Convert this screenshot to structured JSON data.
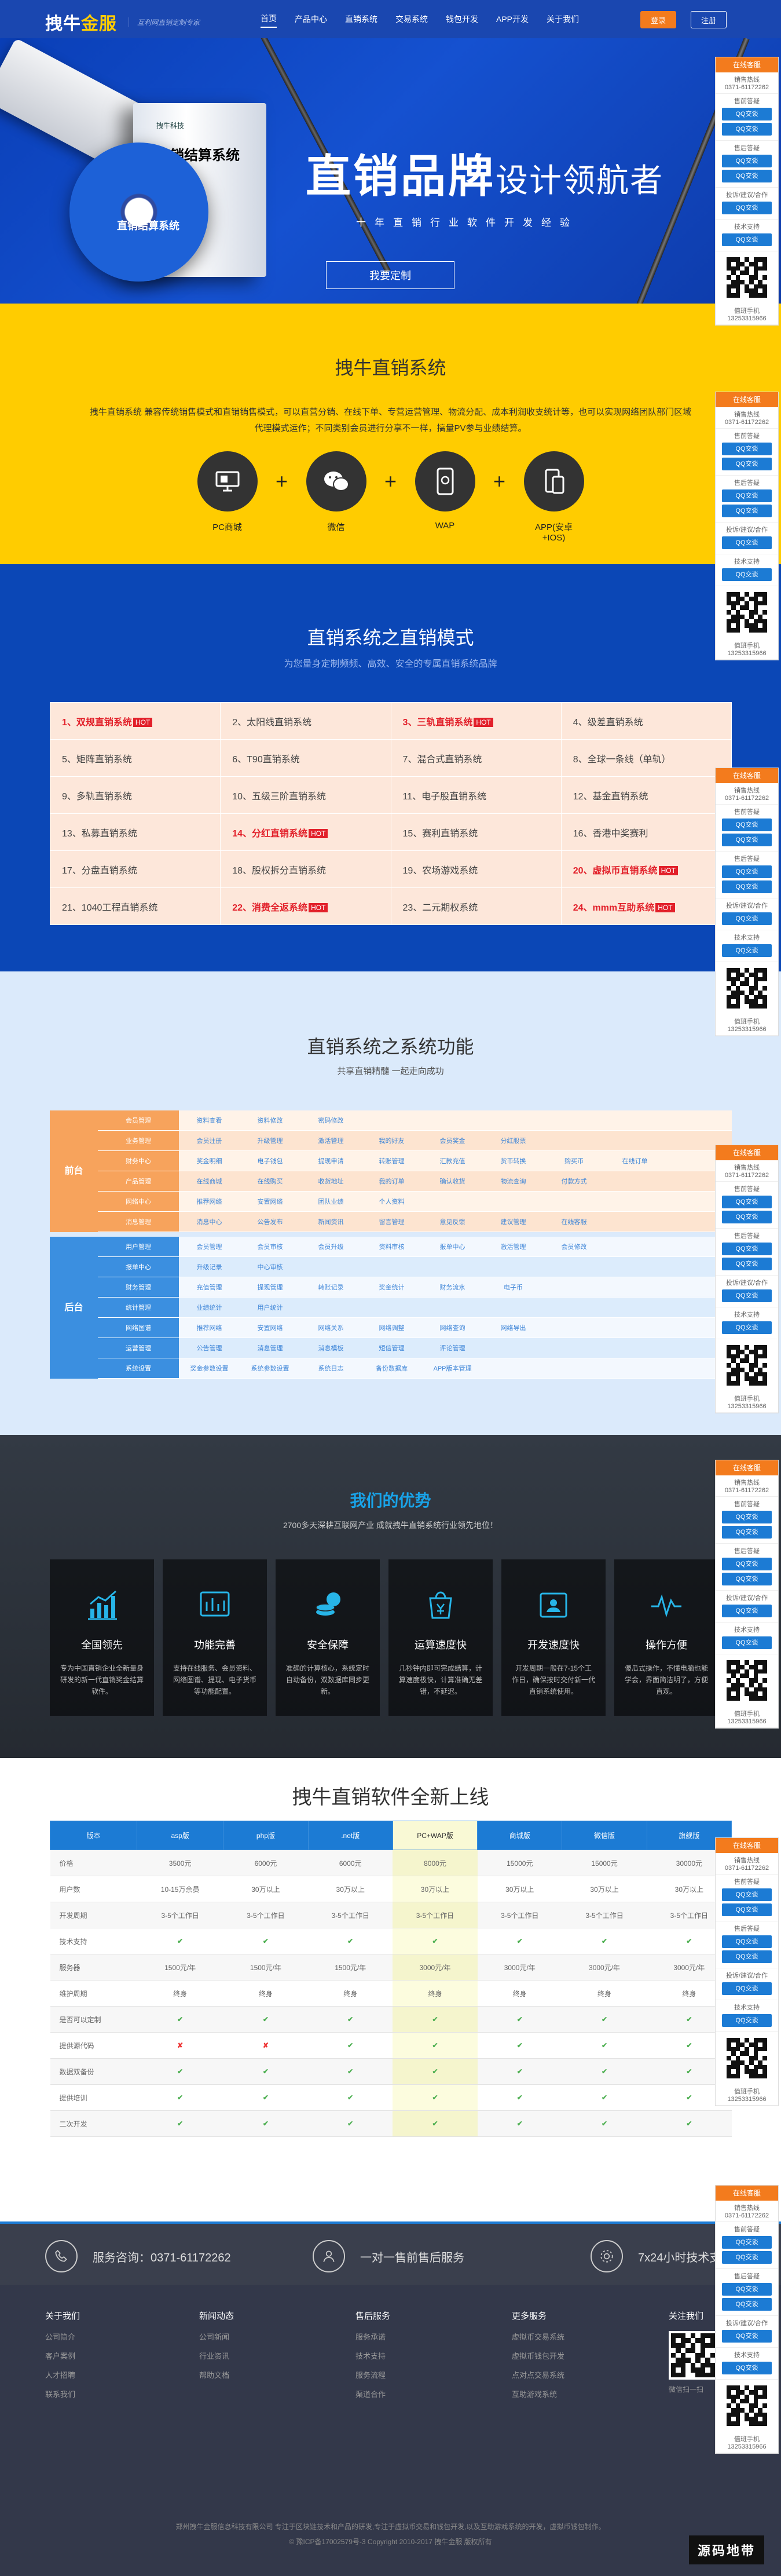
{
  "header": {
    "logo_main": "拽牛",
    "logo_accent": "金服",
    "slogan": "互利网直销定制专家",
    "nav": [
      "首页",
      "产品中心",
      "直销系统",
      "交易系统",
      "钱包开发",
      "APP开发",
      "关于我们"
    ],
    "login": "登录",
    "register": "注册"
  },
  "banner": {
    "box_brand": "拽牛科技",
    "box_title": "直销结算系统",
    "box_edition": "专业版",
    "disc_label": "直销结算系统",
    "title_big": "直销品牌",
    "title_small": "设计领航者",
    "subtitle": "十年直销行业软件开发经验",
    "button": "我要定制"
  },
  "system": {
    "title": "拽牛直销系统",
    "desc": "拽牛直销系统 兼容传统销售模式和直销销售模式，可以直营分销、在线下单、专营运营管理、物流分配、成本利润收支统计等，也可以实现网络团队部门区域代理模式运作；不同类别会员进行分享不一样，搞量PV参与业绩结算。",
    "items": [
      {
        "icon": "pc-icon",
        "label": "PC商城"
      },
      {
        "icon": "wechat-icon",
        "label": "微信"
      },
      {
        "icon": "wap-icon",
        "label": "WAP"
      },
      {
        "icon": "app-icon",
        "label": "APP(安卓+IOS)"
      }
    ]
  },
  "modes": {
    "title": "直销系统之直销模式",
    "subtitle": "为您量身定制频频、高效、安全的专属直销系统品牌",
    "hot_label": "HOT",
    "cells": [
      {
        "text": "1、双规直销系统",
        "hot": true
      },
      {
        "text": "2、太阳线直销系统",
        "hot": false
      },
      {
        "text": "3、三轨直销系统",
        "hot": true
      },
      {
        "text": "4、级差直销系统",
        "hot": false
      },
      {
        "text": "5、矩阵直销系统",
        "hot": false
      },
      {
        "text": "6、T90直销系统",
        "hot": false
      },
      {
        "text": "7、混合式直销系统",
        "hot": false
      },
      {
        "text": "8、全球一条线（单轨）",
        "hot": false
      },
      {
        "text": "9、多轨直销系统",
        "hot": false
      },
      {
        "text": "10、五级三阶直销系统",
        "hot": false
      },
      {
        "text": "11、电子股直销系统",
        "hot": false
      },
      {
        "text": "12、基金直销系统",
        "hot": false
      },
      {
        "text": "13、私募直销系统",
        "hot": false
      },
      {
        "text": "14、分红直销系统",
        "hot": true
      },
      {
        "text": "15、赛利直销系统",
        "hot": false
      },
      {
        "text": "16、香港中奖赛利",
        "hot": false
      },
      {
        "text": "17、分盘直销系统",
        "hot": false
      },
      {
        "text": "18、股权拆分直销系统",
        "hot": false
      },
      {
        "text": "19、农场游戏系统",
        "hot": false
      },
      {
        "text": "20、虚拟币直销系统",
        "hot": true
      },
      {
        "text": "21、1040工程直销系统",
        "hot": false
      },
      {
        "text": "22、消费全返系统",
        "hot": true
      },
      {
        "text": "23、二元期权系统",
        "hot": false
      },
      {
        "text": "24、mmm互助系统",
        "hot": true
      }
    ]
  },
  "func": {
    "title": "直销系统之系统功能",
    "subtitle": "共享直销精髓 一起走向成功",
    "front_label": "前台",
    "back_label": "后台",
    "front_rows": [
      {
        "name": "会员管理",
        "cells": [
          "资料查看",
          "资料修改",
          "密码修改"
        ]
      },
      {
        "name": "业务管理",
        "cells": [
          "会员注册",
          "升级管理",
          "激活管理",
          "我的好友",
          "会员奖金",
          "分红股票"
        ]
      },
      {
        "name": "财务中心",
        "cells": [
          "奖金明细",
          "电子钱包",
          "提现申请",
          "转账管理",
          "汇款充值",
          "货币转换",
          "购买币",
          "在线订单"
        ]
      },
      {
        "name": "产品管理",
        "cells": [
          "在线商城",
          "在线购买",
          "收货地址",
          "我的订单",
          "确认收货",
          "物流查询",
          "付款方式"
        ]
      },
      {
        "name": "网络中心",
        "cells": [
          "推荐网络",
          "安置网络",
          "团队业绩",
          "个人资料"
        ]
      },
      {
        "name": "消息管理",
        "cells": [
          "消息中心",
          "公告发布",
          "新闻资讯",
          "留言管理",
          "意见反馈",
          "建议管理",
          "在线客服"
        ]
      }
    ],
    "back_rows": [
      {
        "name": "用户管理",
        "cells": [
          "会员管理",
          "会员审核",
          "会员升级",
          "资料审核",
          "报单中心",
          "激活管理",
          "会员修改"
        ]
      },
      {
        "name": "报单中心",
        "cells": [
          "升级记录",
          "中心审核"
        ]
      },
      {
        "name": "财务管理",
        "cells": [
          "充值管理",
          "提现管理",
          "转账记录",
          "奖金统计",
          "财务流水",
          "电子币"
        ]
      },
      {
        "name": "统计管理",
        "cells": [
          "业绩统计",
          "用户统计"
        ]
      },
      {
        "name": "网络图谱",
        "cells": [
          "推荐网络",
          "安置网络",
          "网络关系",
          "网络调整",
          "网络查询",
          "网络导出"
        ]
      },
      {
        "name": "运营管理",
        "cells": [
          "公告管理",
          "消息管理",
          "消息模板",
          "短信管理",
          "评论管理"
        ]
      },
      {
        "name": "系统设置",
        "cells": [
          "奖金参数设置",
          "系统参数设置",
          "系统日志",
          "备份数据库",
          "APP版本管理"
        ]
      }
    ]
  },
  "adv": {
    "title": "我们的优势",
    "subtitle": "2700多天深耕互联网产业 成就拽牛直销系统行业领先地位！",
    "cards": [
      {
        "icon": "chart-icon",
        "title": "全国领先",
        "desc": "专为中国直销企业全新量身研发的新一代直销奖金结算软件。"
      },
      {
        "icon": "dashboard-icon",
        "title": "功能完善",
        "desc": "支持在线服务、会员资料、网络图谱、提现、电子货币等功能配置。"
      },
      {
        "icon": "coins-icon",
        "title": "安全保障",
        "desc": "准确的计算核心，系统定时自动备份，双数据库同步更新。"
      },
      {
        "icon": "yen-icon",
        "title": "运算速度快",
        "desc": "几秒钟内即可完成结算，计算速度极快，计算准确无差错，不延迟。"
      },
      {
        "icon": "user-card-icon",
        "title": "开发速度快",
        "desc": "开发周期一般在7-15个工作日，确保按时交付新一代直销系统使用。"
      },
      {
        "icon": "pulse-icon",
        "title": "操作方便",
        "desc": "傻瓜式操作，不懂电脑也能学会，界面简洁明了，方便直观。"
      }
    ]
  },
  "price": {
    "title": "拽牛直销软件全新上线",
    "headers": [
      "版本",
      "asp版",
      "php版",
      ".net版",
      "PC+WAP版",
      "商城版",
      "微信版",
      "旗舰版"
    ],
    "rows": [
      {
        "label": "价格",
        "cells": [
          "3500元",
          "6000元",
          "6000元",
          "8000元",
          "15000元",
          "15000元",
          "30000元"
        ]
      },
      {
        "label": "用户数",
        "cells": [
          "10-15万余员",
          "30万以上",
          "30万以上",
          "30万以上",
          "30万以上",
          "30万以上",
          "30万以上"
        ]
      },
      {
        "label": "开发周期",
        "cells": [
          "3-5个工作日",
          "3-5个工作日",
          "3-5个工作日",
          "3-5个工作日",
          "3-5个工作日",
          "3-5个工作日",
          "3-5个工作日"
        ]
      },
      {
        "label": "技术支持",
        "cells": [
          "ok",
          "ok",
          "ok",
          "ok",
          "ok",
          "ok",
          "ok"
        ]
      },
      {
        "label": "服务器",
        "cells": [
          "1500元/年",
          "1500元/年",
          "1500元/年",
          "3000元/年",
          "3000元/年",
          "3000元/年",
          "3000元/年"
        ]
      },
      {
        "label": "维护周期",
        "cells": [
          "终身",
          "终身",
          "终身",
          "终身",
          "终身",
          "终身",
          "终身"
        ]
      },
      {
        "label": "是否可以定制",
        "cells": [
          "ok",
          "ok",
          "ok",
          "ok",
          "ok",
          "ok",
          "ok"
        ]
      },
      {
        "label": "提供源代码",
        "cells": [
          "no",
          "no",
          "ok",
          "ok",
          "ok",
          "ok",
          "ok"
        ]
      },
      {
        "label": "数据双备份",
        "cells": [
          "ok",
          "ok",
          "ok",
          "ok",
          "ok",
          "ok",
          "ok"
        ]
      },
      {
        "label": "提供培训",
        "cells": [
          "ok",
          "ok",
          "ok",
          "ok",
          "ok",
          "ok",
          "ok"
        ]
      },
      {
        "label": "二次开发",
        "cells": [
          "ok",
          "ok",
          "ok",
          "ok",
          "ok",
          "ok",
          "ok"
        ]
      }
    ]
  },
  "service": {
    "phone": "服务咨询：0371-61172262",
    "after": "一对一售前售后服务",
    "support": "7x24小时技术支持"
  },
  "footer": {
    "cols": [
      {
        "title": "关于我们",
        "links": [
          "公司简介",
          "客户案例",
          "人才招聘",
          "联系我们"
        ]
      },
      {
        "title": "新闻动态",
        "links": [
          "公司新闻",
          "行业资讯",
          "帮助文档"
        ]
      },
      {
        "title": "售后服务",
        "links": [
          "服务承诺",
          "技术支持",
          "服务流程",
          "渠道合作"
        ]
      },
      {
        "title": "更多服务",
        "links": [
          "虚拟币交易系统",
          "虚拟币钱包开发",
          "点对点交易系统",
          "互助游戏系统"
        ]
      }
    ],
    "follow": "关注我们",
    "qr_label": "微信扫一扫",
    "copy1": "郑州拽牛金服信息科技有限公司 专注于区块链技术和产品的研发,专注于虚拟币交易和钱包开发,以及互助游戏系统的开发，虚拟币钱包制作。",
    "copy2": "© 豫ICP备17002579号-3 Copyright 2010-2017 拽牛金服 版权所有",
    "watermark": "源码地带"
  },
  "float": {
    "head": "在线客服",
    "sales": "销售热线",
    "sales_tel": "0371-61172262",
    "pre": "售前答疑",
    "qq": "QQ交谈",
    "after": "售后答疑",
    "complain": "投诉/建议/合作",
    "tech": "技术支持",
    "mobile": "值班手机",
    "mobile_tel": "13253315966"
  }
}
